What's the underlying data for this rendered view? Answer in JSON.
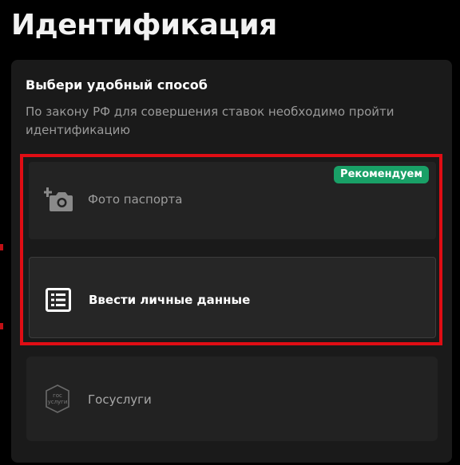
{
  "page": {
    "title": "Идентификация"
  },
  "panel": {
    "heading": "Выбери удобный способ",
    "description": "По закону РФ для совершения ставок необходимо пройти идентификацию"
  },
  "options": {
    "photo": {
      "label": "Фото паспорта",
      "badge": "Рекомендуем",
      "icon": "camera-add-icon"
    },
    "manual": {
      "label": "Ввести личные данные",
      "icon": "form-list-icon"
    },
    "gosuslugi": {
      "label": "Госуслуги",
      "icon": "gosuslugi-logo-icon",
      "logo_text_top": "гос",
      "logo_text_bottom": "услуги"
    }
  },
  "colors": {
    "background": "#000000",
    "panel": "#1a1a1a",
    "badge": "#19a067",
    "highlight": "#e00d14"
  }
}
